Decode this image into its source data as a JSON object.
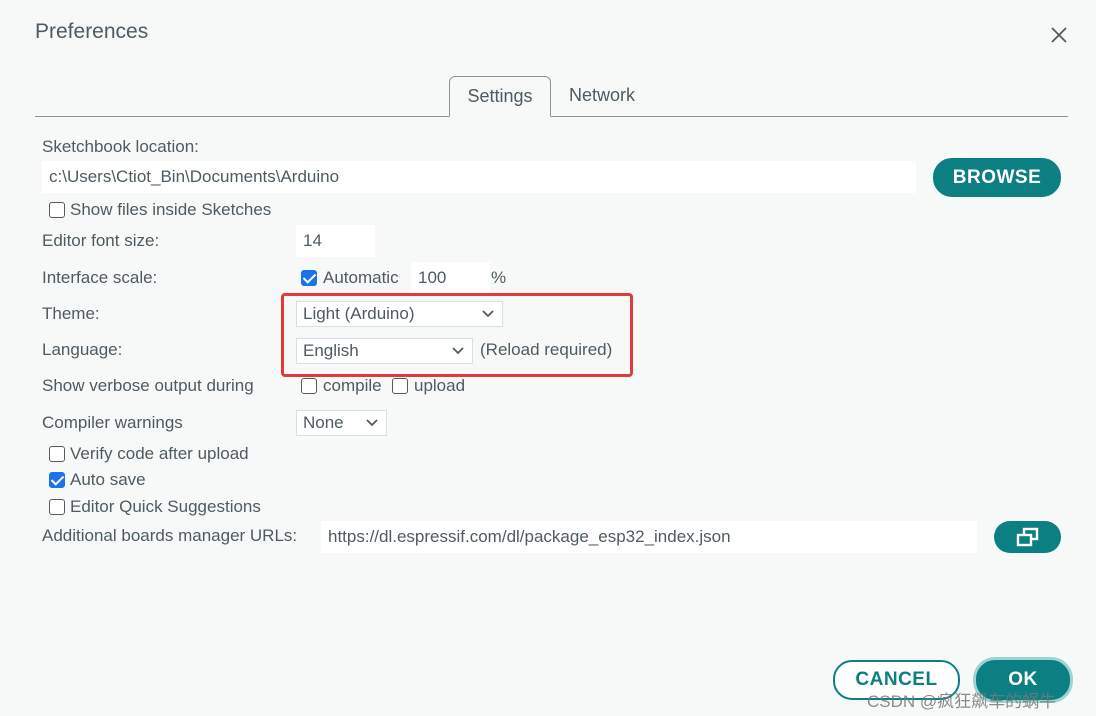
{
  "dialog": {
    "title": "Preferences",
    "close_icon": "close-icon"
  },
  "tabs": [
    {
      "label": "Settings",
      "active": true
    },
    {
      "label": "Network",
      "active": false
    }
  ],
  "sketchbook": {
    "label": "Sketchbook location:",
    "value": "c:\\Users\\Ctiot_Bin\\Documents\\Arduino",
    "browse_label": "BROWSE"
  },
  "show_files": {
    "label": "Show files inside Sketches",
    "checked": false
  },
  "font_size": {
    "label": "Editor font size:",
    "value": "14"
  },
  "interface_scale": {
    "label": "Interface scale:",
    "automatic_label": "Automatic",
    "automatic_checked": true,
    "value": "100",
    "unit": "%"
  },
  "theme": {
    "label": "Theme:",
    "value": "Light (Arduino)"
  },
  "language": {
    "label": "Language:",
    "value": "English",
    "note": "(Reload required)"
  },
  "verbose": {
    "label": "Show verbose output during",
    "compile_label": "compile",
    "compile_checked": false,
    "upload_label": "upload",
    "upload_checked": false
  },
  "compiler_warnings": {
    "label": "Compiler warnings",
    "value": "None"
  },
  "verify": {
    "label": "Verify code after upload",
    "checked": false
  },
  "auto_save": {
    "label": "Auto save",
    "checked": true
  },
  "quick_suggestions": {
    "label": "Editor Quick Suggestions",
    "checked": false
  },
  "boards_urls": {
    "label": "Additional boards manager URLs:",
    "value": "https://dl.espressif.com/dl/package_esp32_index.json",
    "edit_icon": "open-window-icon"
  },
  "footer": {
    "cancel_label": "CANCEL",
    "ok_label": "OK"
  },
  "watermark": "CSDN @疯狂飙车的蜗牛",
  "colors": {
    "accent": "#0c7f82",
    "highlight": "#e23b3b",
    "checkbox": "#1a73e8"
  }
}
